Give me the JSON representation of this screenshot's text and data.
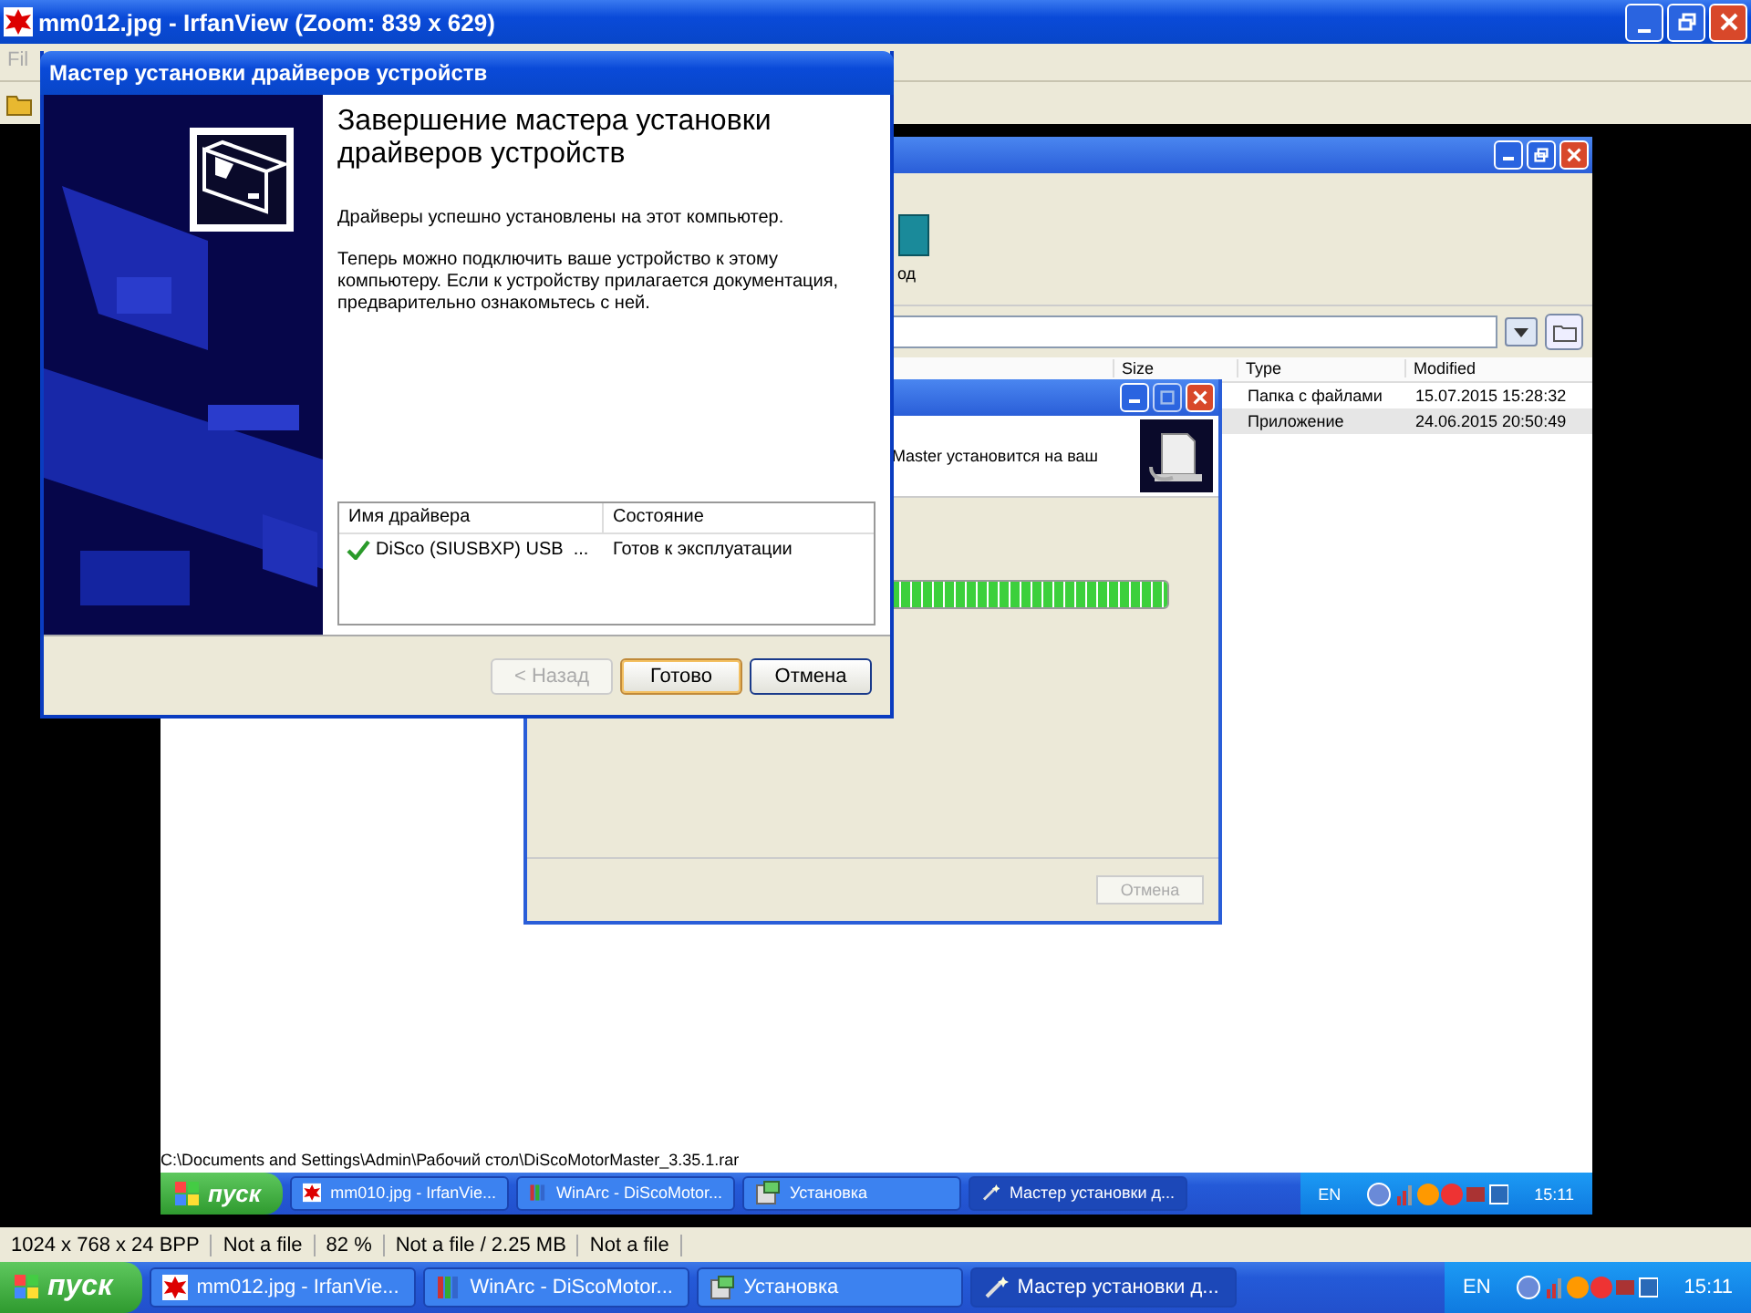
{
  "viewer": {
    "title": "mm012.jpg - IrfanView (Zoom: 839 x 629)",
    "menu": "Fil"
  },
  "image": {
    "archiver": {
      "toolbar_label": "од",
      "columns": [
        "Size",
        "Type",
        "Modified"
      ],
      "rows": [
        {
          "type": "Папка с файлами",
          "modified": "15.07.2015 15:28:32",
          "selected": false
        },
        {
          "type": "Приложение",
          "modified": "24.06.2015 20:50:49",
          "selected": true
        }
      ]
    },
    "installer": {
      "message": "Master установится на ваш",
      "progress": {
        "level": 1
      },
      "cancel": "Отмена"
    },
    "path": "C:\\Documents and Settings\\Admin\\Рабочий стол\\DiScoMotorMaster_3.35.1.rar",
    "taskbar": {
      "start": "пуск",
      "tasks": [
        {
          "label": "mm010.jpg - IrfanVie...",
          "kind": "viewer",
          "selected": false
        },
        {
          "label": "WinArc - DiScoMotor...",
          "kind": "archiver",
          "selected": false
        },
        {
          "label": "Установка",
          "kind": "setup",
          "selected": false
        },
        {
          "label": "Мастер установки д...",
          "kind": "wizard",
          "selected": true
        }
      ],
      "lang": "EN",
      "clock": "15:11"
    }
  },
  "wizard": {
    "title": "Мастер установки драйверов устройств",
    "heading": "Завершение мастера установки драйверов устройств",
    "paragraphs": [
      "Драйверы успешно установлены на этот компьютер.",
      "Теперь можно подключить ваше устройство к этому компьютеру. Если к устройству прилагается документация, предварительно ознакомьтесь с ней."
    ],
    "columns": [
      "Имя драйвера",
      "Состояние"
    ],
    "rows": [
      {
        "name": "DiSco (SIUSBXP) USB  ...",
        "status": "Готов к эксплуатации",
        "ok": true
      }
    ],
    "buttons": [
      {
        "label": "< Назад",
        "disabled": true,
        "default": false
      },
      {
        "label": "Готово",
        "disabled": false,
        "default": true
      },
      {
        "label": "Отмена",
        "disabled": false,
        "default": false
      }
    ]
  },
  "status_bar": [
    "1024 x 768 x 24 BPP",
    "Not a file",
    "82 %",
    "Not a file / 2.25 MB",
    "Not a file"
  ],
  "taskbar": {
    "start": "пуск",
    "tasks": [
      {
        "label": "mm012.jpg - IrfanVie...",
        "kind": "viewer",
        "selected": false
      },
      {
        "label": "WinArc - DiScoMotor...",
        "kind": "archiver",
        "selected": false
      },
      {
        "label": "Установка",
        "kind": "setup",
        "selected": false
      },
      {
        "label": "Мастер установки д...",
        "kind": "wizard",
        "selected": true
      }
    ],
    "lang": "EN",
    "clock": "15:11"
  }
}
